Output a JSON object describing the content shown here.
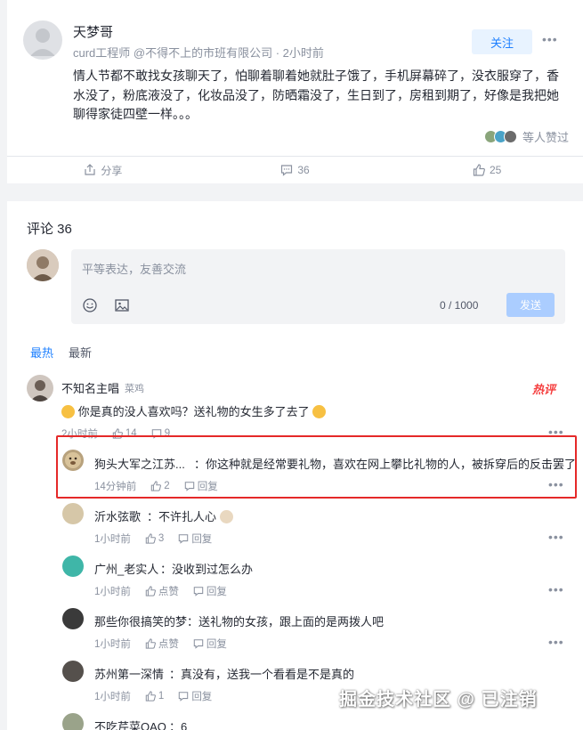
{
  "post": {
    "author": "天梦哥",
    "meta": "curd工程师 @不得不上的市班有限公司 · 2小时前",
    "follow_label": "关注",
    "content": "情人节都不敢找女孩聊天了，怕聊着聊着她就肚子饿了，手机屏幕碎了，没衣服穿了，香水没了，粉底液没了，化妆品没了，防晒霜没了，生日到了，房租到期了，好像是我把她聊得家徒四壁一样。。。",
    "likers_text": "等人赞过",
    "actions": {
      "share": "分享",
      "comments": "36",
      "likes": "25"
    }
  },
  "comments_section": {
    "title": "评论 36",
    "placeholder": "平等表达，友善交流",
    "counter": "0 / 1000",
    "send_label": "发送",
    "sort": {
      "hot": "最热",
      "new": "最新"
    },
    "hot_badge": "热评",
    "top": {
      "name": "不知名主唱",
      "badge": "菜鸡",
      "text": "你是真的没人喜欢吗？送礼物的女生多了去了",
      "time": "2小时前",
      "likes": "14",
      "replies": "9"
    },
    "replies": [
      {
        "name": "狗头大军之江苏...",
        "text": "：你这种就是经常要礼物，喜欢在网上攀比礼物的人，被拆穿后的反击罢了",
        "time": "14分钟前",
        "likes": "2",
        "reply": "回复"
      },
      {
        "name": "沂水弦歌",
        "text": "：不许扎人心",
        "time": "1小时前",
        "likes": "3",
        "reply": "回复"
      },
      {
        "name": "广州_老实人",
        "text": "：没收到过怎么办",
        "time": "1小时前",
        "likes": "点赞",
        "reply": "回复"
      },
      {
        "name": "那些你很搞笑的梦",
        "text": "：送礼物的女孩，跟上面的是两拨人吧",
        "time": "1小时前",
        "likes": "点赞",
        "reply": "回复"
      },
      {
        "name": "苏州第一深情",
        "text": "：真没有，送我一个看看是不是真的",
        "time": "1小时前",
        "likes": "1",
        "reply": "回复"
      },
      {
        "name": "不吃芹菜OAO",
        "text": "：6",
        "time": "",
        "likes": "",
        "reply": ""
      }
    ]
  },
  "watermark": "掘金技术社区 @ 已注销"
}
